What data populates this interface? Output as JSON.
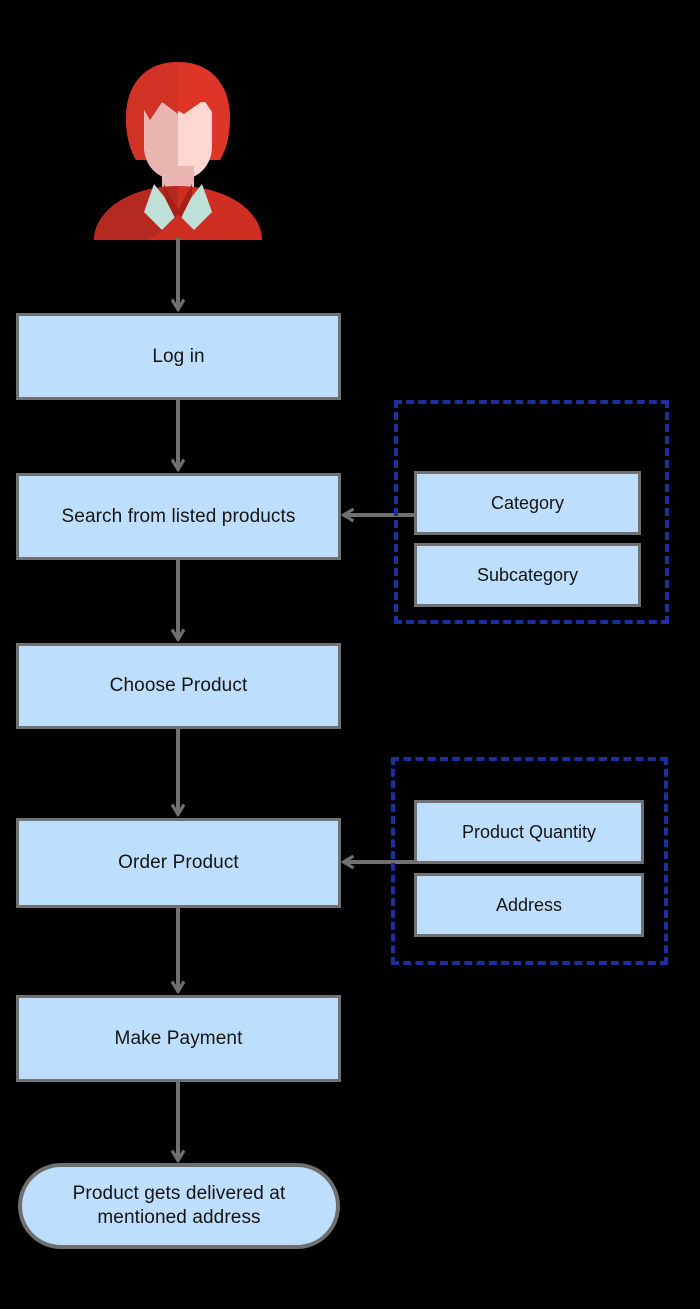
{
  "diagram": {
    "title": "Online shopping order process flowchart",
    "background_color": "#000000",
    "node_fill": "#bddffd",
    "node_border": "#717171",
    "group_border": "#1c2f9c",
    "arrow_color": "#707070",
    "actor": {
      "name": "user-avatar",
      "hair_color": "#dd3528",
      "face_color": "#ffd7d2",
      "shirt_color": "#cf2e22",
      "collar_color": "#bfe0d6"
    },
    "main_steps": [
      {
        "id": "login",
        "label": "Log in",
        "shape": "rect"
      },
      {
        "id": "search",
        "label": "Search from listed products",
        "shape": "rect"
      },
      {
        "id": "choose",
        "label": "Choose Product",
        "shape": "rect"
      },
      {
        "id": "order",
        "label": "Order Product",
        "shape": "rect"
      },
      {
        "id": "payment",
        "label": "Make Payment",
        "shape": "rect"
      },
      {
        "id": "delivered",
        "label": "Product gets delivered at mentioned address",
        "shape": "rounded-terminal"
      }
    ],
    "groups": [
      {
        "id": "search-filters",
        "target": "search",
        "items": [
          {
            "id": "category",
            "label": "Category"
          },
          {
            "id": "subcategory",
            "label": "Subcategory"
          }
        ]
      },
      {
        "id": "order-details",
        "target": "order",
        "items": [
          {
            "id": "product-quantity",
            "label": "Product Quantity"
          },
          {
            "id": "address",
            "label": "Address"
          }
        ]
      }
    ],
    "edges": [
      {
        "from": "actor",
        "to": "login",
        "direction": "down"
      },
      {
        "from": "login",
        "to": "search",
        "direction": "down"
      },
      {
        "from": "search-filters",
        "to": "search",
        "direction": "left"
      },
      {
        "from": "search",
        "to": "choose",
        "direction": "down"
      },
      {
        "from": "choose",
        "to": "order",
        "direction": "down"
      },
      {
        "from": "order-details",
        "to": "order",
        "direction": "left"
      },
      {
        "from": "order",
        "to": "payment",
        "direction": "down"
      },
      {
        "from": "payment",
        "to": "delivered",
        "direction": "down"
      }
    ]
  }
}
